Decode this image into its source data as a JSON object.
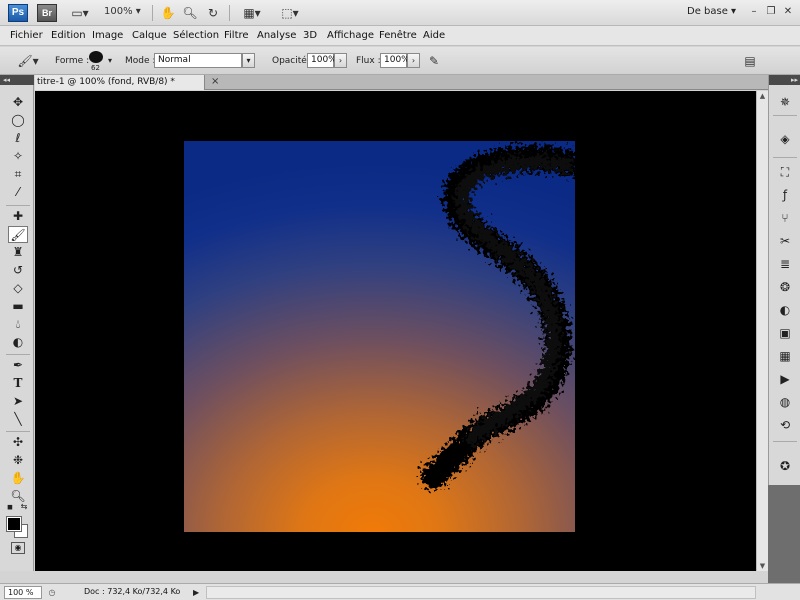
{
  "appbar": {
    "ps_logo": "Ps",
    "br_logo": "Br",
    "zoom": "100%",
    "workspace": "De base",
    "icons": [
      "screen-mode-icon",
      "hand-icon",
      "zoom-icon",
      "rotate-view-icon",
      "arrange-documents-icon",
      "screen-layout-icon"
    ]
  },
  "menu": [
    "Fichier",
    "Edition",
    "Image",
    "Calque",
    "Sélection",
    "Filtre",
    "Analyse",
    "3D",
    "Affichage",
    "Fenêtre",
    "Aide"
  ],
  "options": {
    "forme_label": "Forme :",
    "brush_size": "62",
    "mode_label": "Mode :",
    "mode_value": "Normal",
    "opacite_label": "Opacité :",
    "opacite_value": "100%",
    "flux_label": "Flux :",
    "flux_value": "100%"
  },
  "document": {
    "tab_title": "titre-1 @ 100% (fond, RVB/8) *",
    "tab_close": "×"
  },
  "status": {
    "zoom": "100 %",
    "doc_info": "Doc : 732,4 Ko/732,4 Ko"
  },
  "colors": {
    "gradient_bottom": "#f07a08",
    "gradient_top": "#0a2a85",
    "foreground": "#000000",
    "background": "#ffffff"
  }
}
